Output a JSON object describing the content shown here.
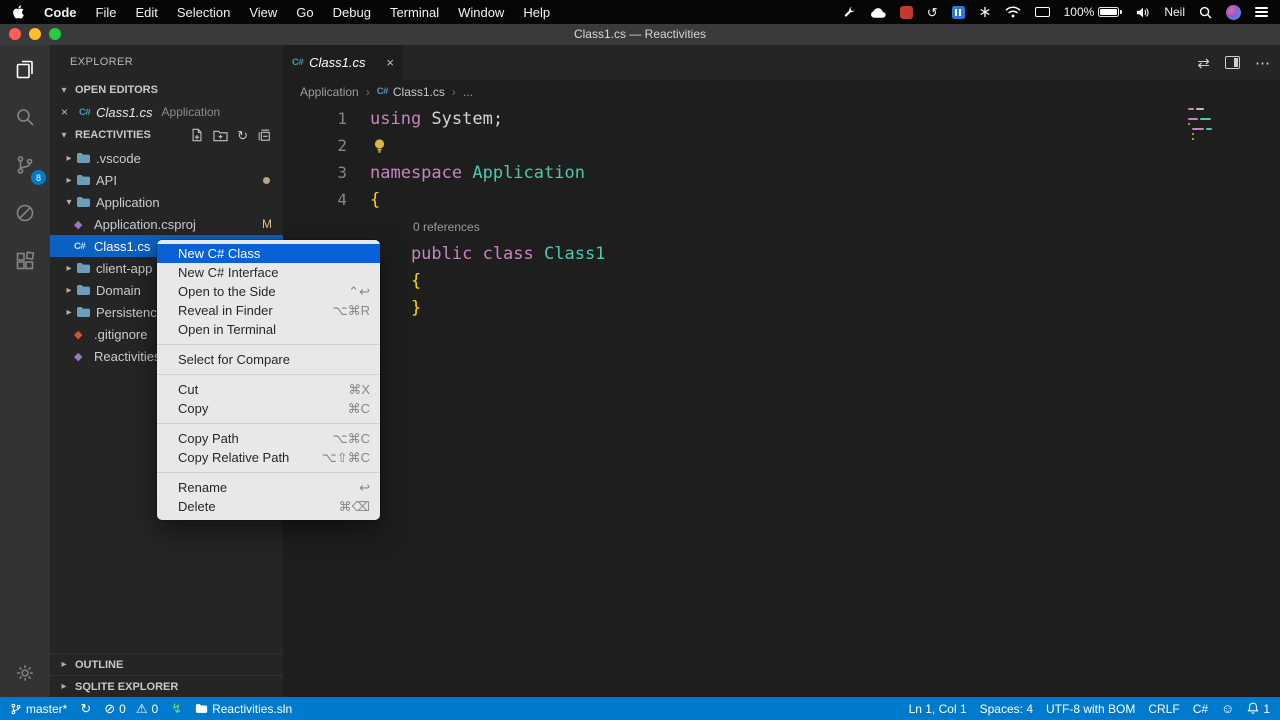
{
  "colors": {
    "statusbar": "#007acc",
    "list_selection": "#0b61c4",
    "menu_highlight": "#0a60d7",
    "keyword": "#c586c0",
    "type_name": "#4ec9b0",
    "brace": "#ffd700",
    "git_modified": "#e2c08d"
  },
  "icons": {
    "close": "×",
    "chevron_collapsed": "▸",
    "chevron_expanded": "▾",
    "breadcrumb_separator": "›",
    "more_actions": "⋯",
    "open_changes": "⇄",
    "refresh": "↻",
    "undo_clock": "↺",
    "error": "⊘",
    "warning": "⚠",
    "zap": "↯",
    "smiley": "☺",
    "diamond": "◆",
    "csharp": "C#"
  },
  "menubar": {
    "items": [
      "Code",
      "File",
      "Edit",
      "Selection",
      "View",
      "Go",
      "Debug",
      "Terminal",
      "Window",
      "Help"
    ],
    "status": {
      "battery": "100%",
      "user": "Neil"
    }
  },
  "titlebar": {
    "title": "Class1.cs — Reactivities"
  },
  "activity_bar": {
    "source_control_badge": "8"
  },
  "sidebar": {
    "title": "EXPLORER",
    "open_editors": {
      "header": "OPEN EDITORS",
      "items": [
        {
          "name": "Class1.cs",
          "detail": "Application"
        }
      ]
    },
    "project": {
      "header": "REACTIVITIES",
      "tree": [
        {
          "name": ".vscode"
        },
        {
          "name": "API"
        },
        {
          "name": "Application"
        },
        {
          "name": "Application.csproj",
          "badge": "M"
        },
        {
          "name": "Class1.cs"
        },
        {
          "name": "client-app"
        },
        {
          "name": "Domain"
        },
        {
          "name": "Persistence"
        },
        {
          "name": ".gitignore"
        },
        {
          "name": "Reactivities.sln"
        }
      ]
    },
    "bottom_sections": [
      {
        "header": "OUTLINE"
      },
      {
        "header": "SQLITE EXPLORER"
      }
    ]
  },
  "context_menu": {
    "items": [
      {
        "label": "New C# Class"
      },
      {
        "label": "New C# Interface"
      },
      {
        "label": "Open to the Side",
        "shortcut": "⌃↩"
      },
      {
        "label": "Reveal in Finder",
        "shortcut": "⌥⌘R"
      },
      {
        "label": "Open in Terminal"
      },
      {
        "label": "Select for Compare"
      },
      {
        "label": "Cut",
        "shortcut": "⌘X"
      },
      {
        "label": "Copy",
        "shortcut": "⌘C"
      },
      {
        "label": "Copy Path",
        "shortcut": "⌥⌘C"
      },
      {
        "label": "Copy Relative Path",
        "shortcut": "⌥⇧⌘C"
      },
      {
        "label": "Rename",
        "shortcut": "↩"
      },
      {
        "label": "Delete",
        "shortcut": "⌘⌫"
      }
    ]
  },
  "editor": {
    "tab": {
      "name": "Class1.cs"
    },
    "breadcrumb": {
      "root": "Application",
      "file": "Class1.cs",
      "more": "..."
    },
    "code": {
      "lines": [
        {
          "num": "1",
          "tokens": [
            {
              "t": "using "
            },
            {
              "t": "System"
            },
            {
              "t": ";"
            }
          ]
        },
        {
          "num": "2",
          "tokens": []
        },
        {
          "num": "3",
          "tokens": [
            {
              "t": "namespace "
            },
            {
              "t": "Application"
            }
          ]
        },
        {
          "num": "4",
          "tokens": [
            {
              "t": "{"
            }
          ]
        },
        {
          "num": "",
          "codelens": "0 references"
        },
        {
          "num": "",
          "tokens": [
            {
              "t": "    public class "
            },
            {
              "t": "Class1"
            }
          ]
        },
        {
          "num": "",
          "tokens": [
            {
              "t": "    {"
            }
          ]
        },
        {
          "num": "",
          "tokens": [
            {
              "t": "    }"
            }
          ]
        }
      ]
    }
  },
  "status_bar": {
    "branch": "master*",
    "errors": "0",
    "warnings": "0",
    "project": "Reactivities.sln",
    "cursor": "Ln 1, Col 1",
    "indent": "Spaces: 4",
    "encoding": "UTF-8 with BOM",
    "eol": "CRLF",
    "language": "C#",
    "notifications": "1"
  }
}
